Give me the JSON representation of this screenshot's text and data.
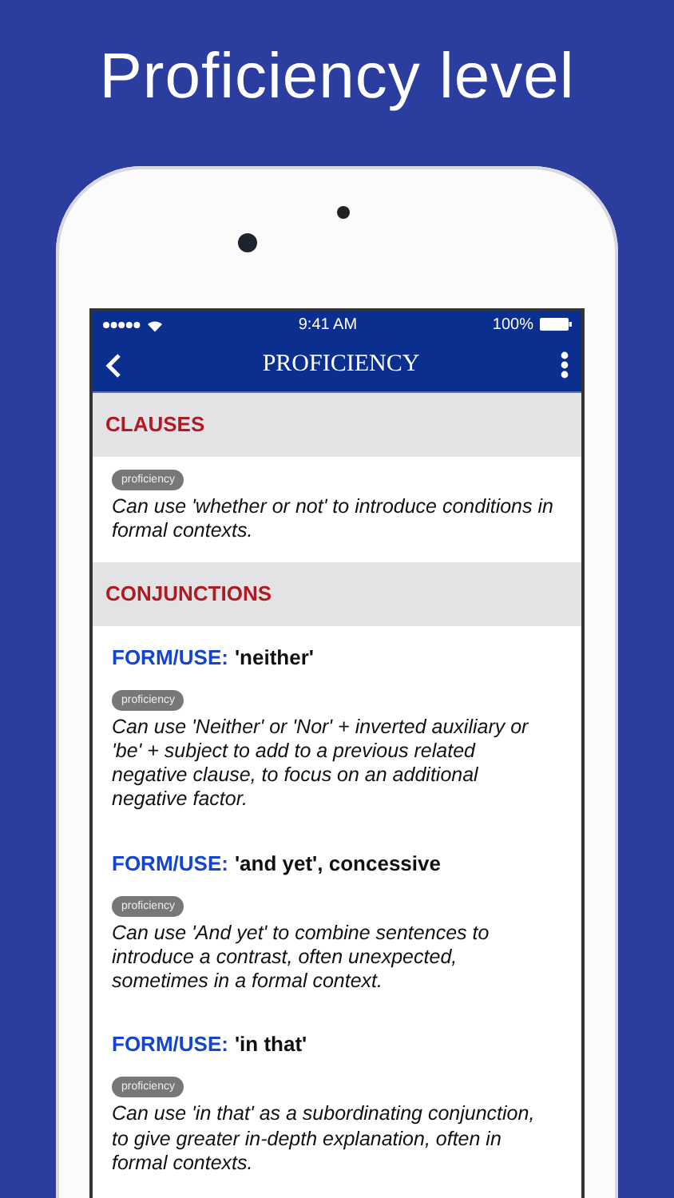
{
  "headline": "Proficiency level",
  "status_bar": {
    "time": "9:41 AM",
    "battery": "100%"
  },
  "nav": {
    "title": "PROFICIENCY"
  },
  "sections": [
    {
      "title": "CLAUSES",
      "items": [
        {
          "badge": "proficiency",
          "description": "Can use 'whether or not' to introduce conditions in formal contexts."
        }
      ]
    },
    {
      "title": "CONJUNCTIONS",
      "items": [
        {
          "label": "FORM/USE:",
          "heading": "'neither'",
          "badge": "proficiency",
          "description": "Can use 'Neither' or 'Nor' + inverted auxiliary or 'be' + subject to add to a previous related negative clause, to focus on an additional negative factor."
        },
        {
          "label": "FORM/USE:",
          "heading": "'and yet', concessive",
          "badge": "proficiency",
          "description": "Can use 'And yet' to combine sentences to introduce a contrast, often unexpected, sometimes in a formal context."
        },
        {
          "label": "FORM/USE:",
          "heading": "'in that'",
          "badge": "proficiency",
          "description": "Can use 'in that' as a subordinating conjunction, to give greater in-depth explanation, often in formal contexts."
        }
      ]
    }
  ]
}
